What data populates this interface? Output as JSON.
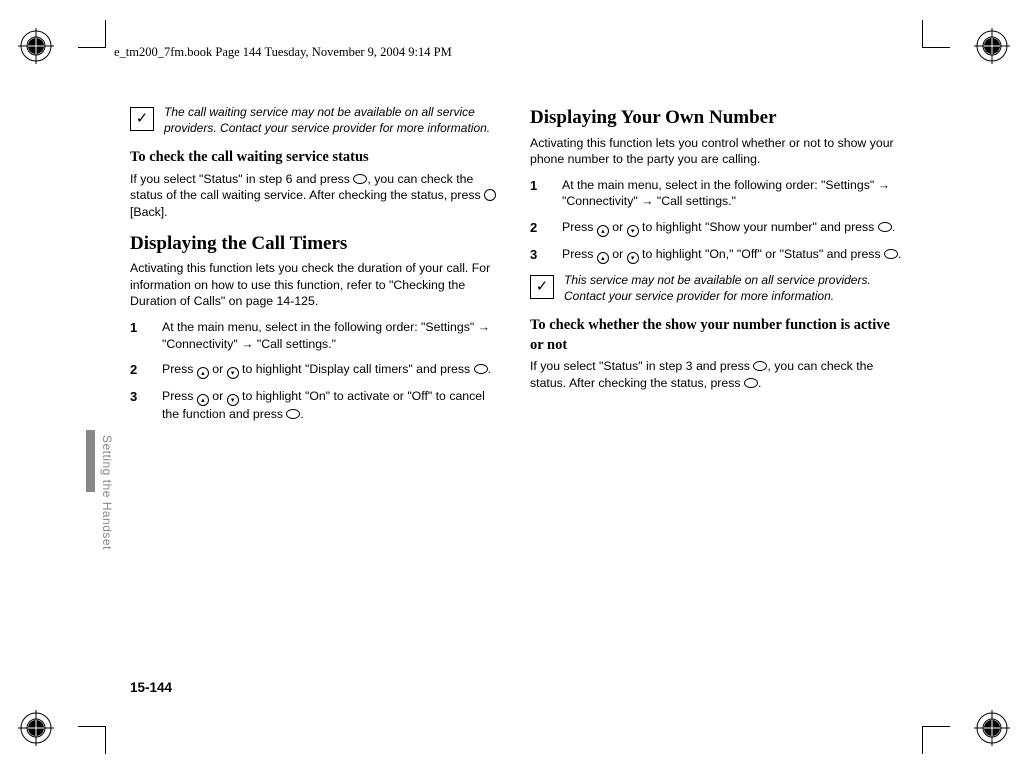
{
  "header": "e_tm200_7fm.book  Page 144  Tuesday, November 9, 2004  9:14 PM",
  "sidelabel": "Setting the Handset",
  "pagenum": "15-144",
  "col1": {
    "note1": "The call waiting service may not be available on all service providers. Contact your service provider for more information.",
    "sub1": "To check the call waiting service status",
    "p1a": "If you select \"Status\" in step 6 and press ",
    "p1b": ", you can check the status of the call waiting service. After checking the status, press ",
    "p1c": " [Back].",
    "h2": "Displaying the Call Timers",
    "p2": "Activating this function lets you check the duration of your call. For information on how to use this function, refer to \"Checking the Duration of Calls\" on page 14-125.",
    "s1": "At the main menu, select in the following order: \"Settings\" → \"Connectivity\" → \"Call settings.\"",
    "s2a": "Press ",
    "s2b": " or ",
    "s2c": " to highlight \"Display call timers\" and press ",
    "s2d": ".",
    "s3a": "Press ",
    "s3b": " or ",
    "s3c": " to highlight \"On\" to activate or \"Off\" to cancel the function and press ",
    "s3d": "."
  },
  "col2": {
    "h2": "Displaying Your Own Number",
    "p1": "Activating this function lets you control whether or not to show your phone number to the party you are calling.",
    "s1": "At the main menu, select in the following order: \"Settings\" → \"Connectivity\" → \"Call settings.\"",
    "s2a": "Press ",
    "s2b": " or ",
    "s2c": " to highlight \"Show your number\" and press  ",
    "s2d": ".",
    "s3a": "Press ",
    "s3b": " or ",
    "s3c": " to highlight \"On,\" \"Off\" or \"Status\" and press ",
    "s3d": ".",
    "note1": "This service may not be available on all service providers. Contact your service provider for more information.",
    "sub1": "To check whether the show your number function is active or not",
    "p2a": "If you select \"Status\" in step 3 and press ",
    "p2b": ", you can check the status. After checking the status, press ",
    "p2c": "."
  },
  "nums": {
    "n1": "1",
    "n2": "2",
    "n3": "3"
  }
}
